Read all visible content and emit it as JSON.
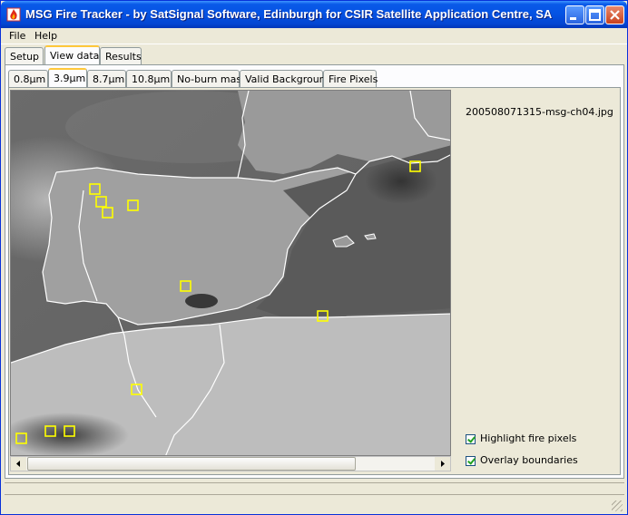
{
  "window": {
    "title": "MSG Fire Tracker - by SatSignal Software, Edinburgh for CSIR Satellite Application Centre, SA",
    "controls": [
      "minimize",
      "maximize",
      "close"
    ]
  },
  "menu": {
    "file": "File",
    "help": "Help"
  },
  "main_tabs": [
    {
      "label": "Setup",
      "active": false
    },
    {
      "label": "View data",
      "active": true
    },
    {
      "label": "Results",
      "active": false
    }
  ],
  "channel_tabs": [
    {
      "label": "0.8µm",
      "active": false
    },
    {
      "label": "3.9µm",
      "active": true
    },
    {
      "label": "8.7µm",
      "active": false
    },
    {
      "label": "10.8µm",
      "active": false
    },
    {
      "label": "No-burn mask",
      "active": false
    },
    {
      "label": "Valid Background",
      "active": false
    },
    {
      "label": "Fire Pixels",
      "active": false
    }
  ],
  "image": {
    "filename": "200508071315-msg-ch04.jpg",
    "icon": "satellite-image"
  },
  "options": {
    "highlight_fire_pixels": {
      "label": "Highlight fire pixels",
      "checked": true
    },
    "overlay_boundaries": {
      "label": "Overlay boundaries",
      "checked": true
    }
  },
  "colors": {
    "highlight": "#ffff00",
    "title_bar": "#0553e4"
  }
}
